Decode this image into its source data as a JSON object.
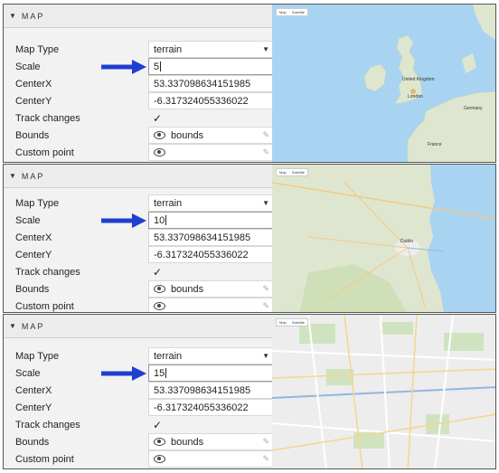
{
  "panels": [
    {
      "header": "MAP",
      "map_type_label": "Map Type",
      "map_type_value": "terrain",
      "scale_label": "Scale",
      "scale_value": "5",
      "centerx_label": "CenterX",
      "centerx_value": "53.337098634151985",
      "centery_label": "CenterY",
      "centery_value": "-6.317324055336022",
      "track_label": "Track changes",
      "track_checked": true,
      "bounds_label": "Bounds",
      "bounds_value": "bounds",
      "custom_label": "Custom point"
    },
    {
      "header": "MAP",
      "map_type_label": "Map Type",
      "map_type_value": "terrain",
      "scale_label": "Scale",
      "scale_value": "10",
      "centerx_label": "CenterX",
      "centerx_value": "53.337098634151985",
      "centery_label": "CenterY",
      "centery_value": "-6.317324055336022",
      "track_label": "Track changes",
      "track_checked": true,
      "bounds_label": "Bounds",
      "bounds_value": "bounds",
      "custom_label": "Custom point"
    },
    {
      "header": "MAP",
      "map_type_label": "Map Type",
      "map_type_value": "terrain",
      "scale_label": "Scale",
      "scale_value": "15",
      "centerx_label": "CenterX",
      "centerx_value": "53.337098634151985",
      "centery_label": "CenterY",
      "centery_value": "-6.317324055336022",
      "track_label": "Track changes",
      "track_checked": true,
      "bounds_label": "Bounds",
      "bounds_value": "bounds",
      "custom_label": "Custom point"
    }
  ],
  "maps": [
    {
      "tabs": [
        "Map",
        "Satellite"
      ],
      "labels": [
        "United Kingdom",
        "London",
        "Germany",
        "France"
      ]
    },
    {
      "tabs": [
        "Map",
        "Satellite"
      ],
      "labels": [
        "Dublin"
      ]
    },
    {
      "tabs": [
        "Map",
        "Satellite"
      ],
      "labels": []
    }
  ],
  "icons": {
    "caret": "caret-down-icon",
    "eye": "eye-icon",
    "check": "checkmark-icon",
    "pencil": "pencil-icon",
    "arrow": "arrow-right-icon",
    "select": "chevron-down-icon"
  },
  "colors": {
    "arrow": "#1f3fd1",
    "water": "#a8d4f2",
    "land_terrain": "#dfe6cf",
    "land_green": "#cfdfb8",
    "city": "#ededed"
  }
}
